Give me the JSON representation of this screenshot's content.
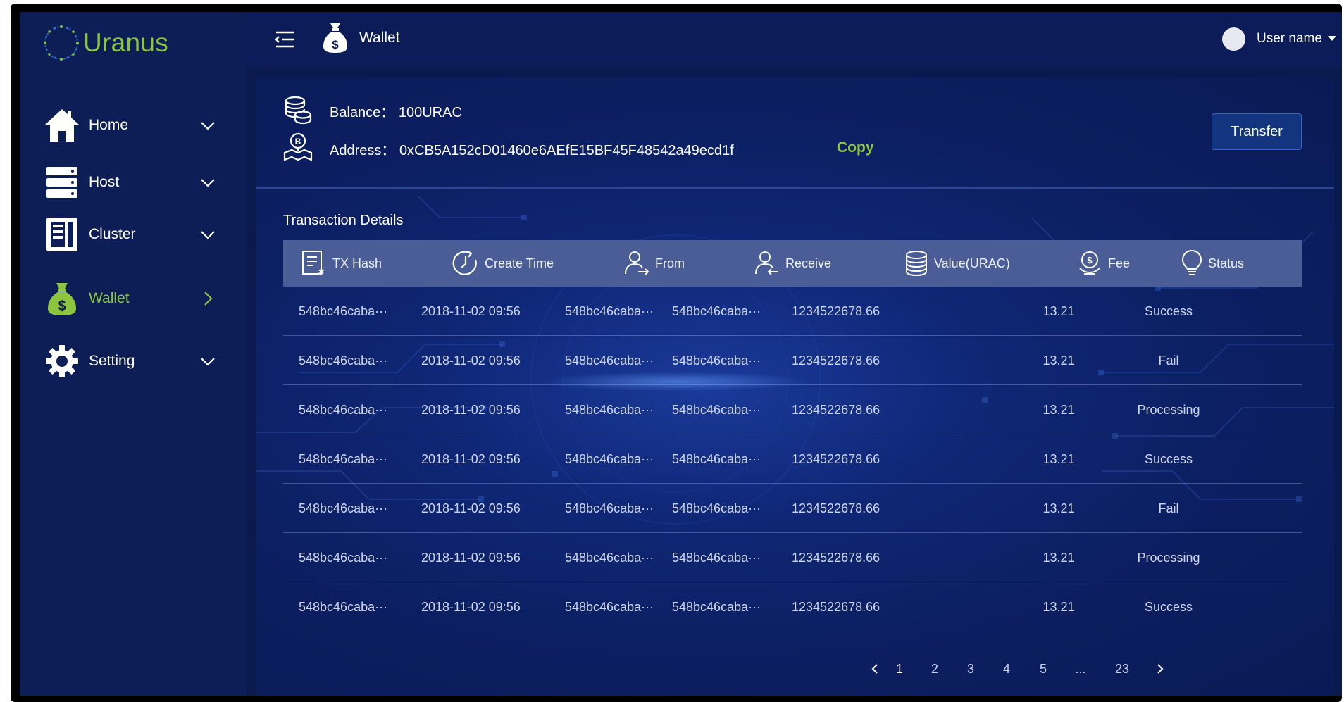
{
  "app": {
    "name": "Uranus"
  },
  "sidebar": {
    "items": [
      {
        "label": "Home"
      },
      {
        "label": "Host"
      },
      {
        "label": "Cluster"
      },
      {
        "label": "Wallet"
      },
      {
        "label": "Setting"
      }
    ],
    "active": "Wallet"
  },
  "topbar": {
    "title": "Wallet",
    "user_name": "User name"
  },
  "wallet": {
    "balance_label": "Balance：",
    "balance_value": "100URAC",
    "address_label": "Address：",
    "address_value": "0xCB5A152cD01460e6AEfE15BF45F48542a49ecd1f",
    "copy_label": "Copy",
    "transfer_label": "Transfer"
  },
  "transactions": {
    "title": "Transaction Details",
    "columns": [
      "TX Hash",
      "Create Time",
      "From",
      "Receive",
      "Value(URAC)",
      "Fee",
      "Status"
    ],
    "rows": [
      [
        "548bc46caba···",
        "2018-11-02 09:56",
        "548bc46caba···",
        "548bc46caba···",
        "1234522678.66",
        "13.21",
        "Success"
      ],
      [
        "548bc46caba···",
        "2018-11-02 09:56",
        "548bc46caba···",
        "548bc46caba···",
        "1234522678.66",
        "13.21",
        "Fail"
      ],
      [
        "548bc46caba···",
        "2018-11-02 09:56",
        "548bc46caba···",
        "548bc46caba···",
        "1234522678.66",
        "13.21",
        "Processing"
      ],
      [
        "548bc46caba···",
        "2018-11-02 09:56",
        "548bc46caba···",
        "548bc46caba···",
        "1234522678.66",
        "13.21",
        "Success"
      ],
      [
        "548bc46caba···",
        "2018-11-02 09:56",
        "548bc46caba···",
        "548bc46caba···",
        "1234522678.66",
        "13.21",
        "Fail"
      ],
      [
        "548bc46caba···",
        "2018-11-02 09:56",
        "548bc46caba···",
        "548bc46caba···",
        "1234522678.66",
        "13.21",
        "Processing"
      ],
      [
        "548bc46caba···",
        "2018-11-02 09:56",
        "548bc46caba···",
        "548bc46caba···",
        "1234522678.66",
        "13.21",
        "Success"
      ]
    ]
  },
  "pagination": {
    "prev": "<",
    "next": ">",
    "pages": [
      "1",
      "2",
      "3",
      "4",
      "5",
      "...",
      "23"
    ],
    "current": "1"
  },
  "icons": {
    "menu": "menu-fold-icon",
    "wallet": "money-bag-icon",
    "home": "home-icon",
    "host": "server-icon",
    "cluster": "cluster-icon",
    "setting": "gear-icon"
  },
  "colors": {
    "brand_green": "#8cc63f",
    "sidebar_bg": "#0d1d55",
    "panel_bg": "#0c1f62",
    "table_header_bg": "#4a5d97",
    "button_bg": "#13357f"
  }
}
